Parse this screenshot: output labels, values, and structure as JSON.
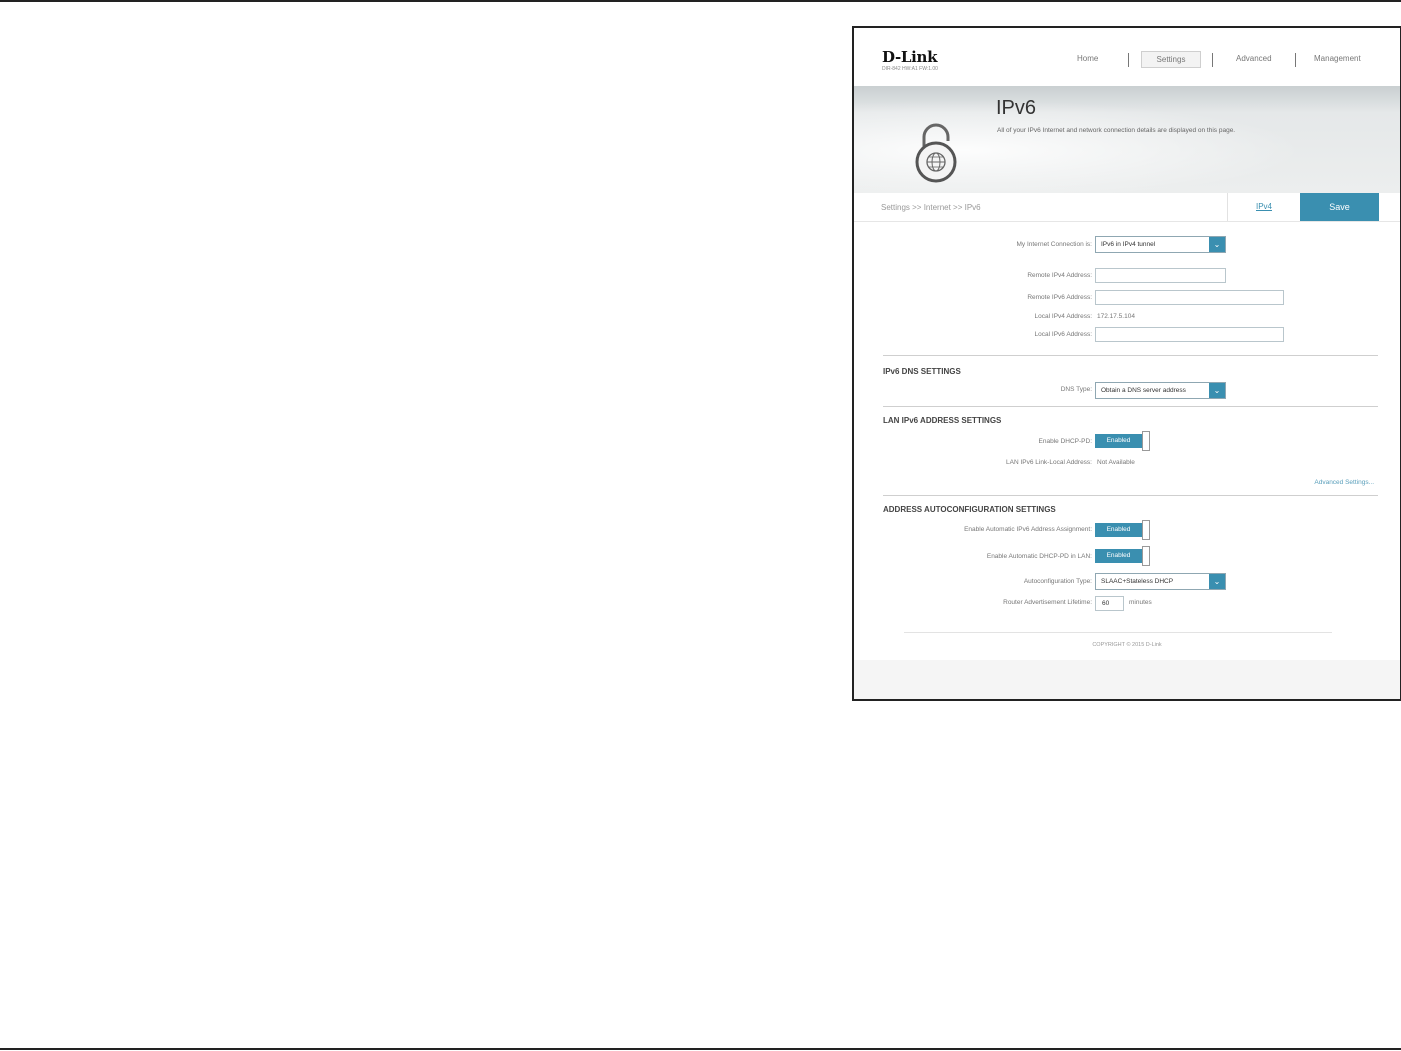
{
  "header": {
    "logo": "D-Link",
    "logo_sub": "DIR-842   HW:A1   FW:1.00",
    "nav": {
      "home": "Home",
      "settings": "Settings",
      "advanced": "Advanced",
      "management": "Management"
    }
  },
  "banner": {
    "title": "IPv6",
    "description": "All of your IPv6 Internet and network connection details are displayed on this page."
  },
  "toolbar": {
    "breadcrumb": "Settings >> Internet >> IPv6",
    "ipv4_link": "IPv4",
    "save_label": "Save"
  },
  "form": {
    "connection_label": "My Internet Connection is:",
    "connection_value": "IPv6 in IPv4 tunnel",
    "remote_ipv4_label": "Remote IPv4 Address:",
    "remote_ipv6_label": "Remote IPv6 Address:",
    "local_ipv4_label": "Local IPv4 Address:",
    "local_ipv4_value": "172.17.5.104",
    "local_ipv6_label": "Local IPv6 Address:"
  },
  "dns": {
    "section_title": "IPv6 DNS SETTINGS",
    "type_label": "DNS Type:",
    "type_value": "Obtain a DNS server address"
  },
  "lan": {
    "section_title": "LAN IPv6 ADDRESS SETTINGS",
    "dhcp_pd_label": "Enable DHCP-PD:",
    "dhcp_pd_value": "Enabled",
    "link_local_label": "LAN IPv6 Link-Local Address:",
    "link_local_value": "Not Available",
    "advanced_link": "Advanced Settings..."
  },
  "autoconf": {
    "section_title": "ADDRESS AUTOCONFIGURATION SETTINGS",
    "auto_assign_label": "Enable Automatic IPv6 Address Assignment:",
    "auto_assign_value": "Enabled",
    "auto_dhcp_pd_label": "Enable Automatic DHCP-PD in LAN:",
    "auto_dhcp_pd_value": "Enabled",
    "type_label": "Autoconfiguration Type:",
    "type_value": "SLAAC+Stateless DHCP",
    "lifetime_label": "Router Advertisement Lifetime:",
    "lifetime_value": "60",
    "lifetime_unit": "minutes"
  },
  "footer": {
    "copyright": "COPYRIGHT © 2015 D-Link"
  },
  "colors": {
    "accent": "#3a8fb0"
  }
}
